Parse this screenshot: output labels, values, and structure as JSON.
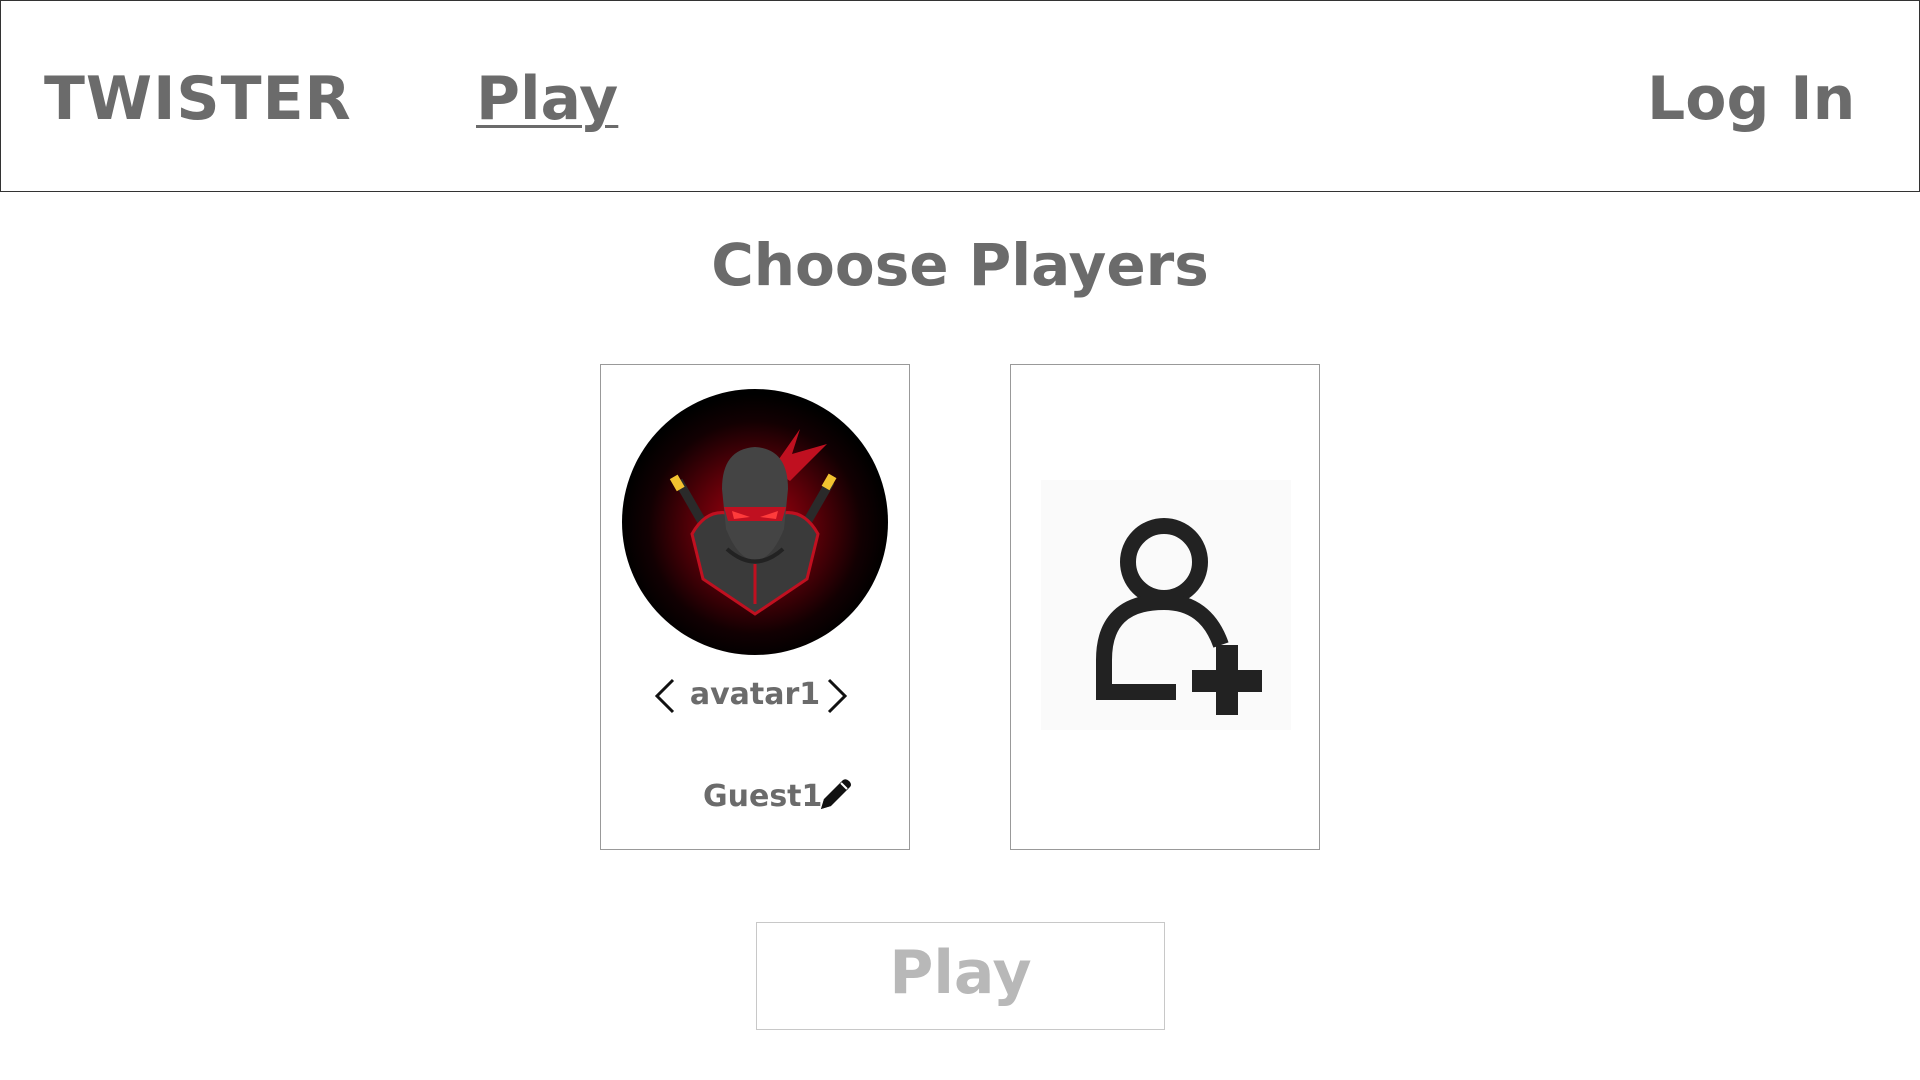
{
  "nav": {
    "brand": "TWISTER",
    "play_link": "Play",
    "login_link": "Log In"
  },
  "page": {
    "title": "Choose Players"
  },
  "players": [
    {
      "avatar_label": "avatar1",
      "name": "Guest1",
      "avatar_icon": "ninja-avatar"
    }
  ],
  "add_player": {
    "icon": "add-user-icon"
  },
  "play_button": {
    "label": "Play",
    "state": "disabled"
  },
  "colors": {
    "text": "#6b6b6b",
    "disabled_text": "#b8b8b8",
    "border": "#333333",
    "card_border": "#999999"
  }
}
